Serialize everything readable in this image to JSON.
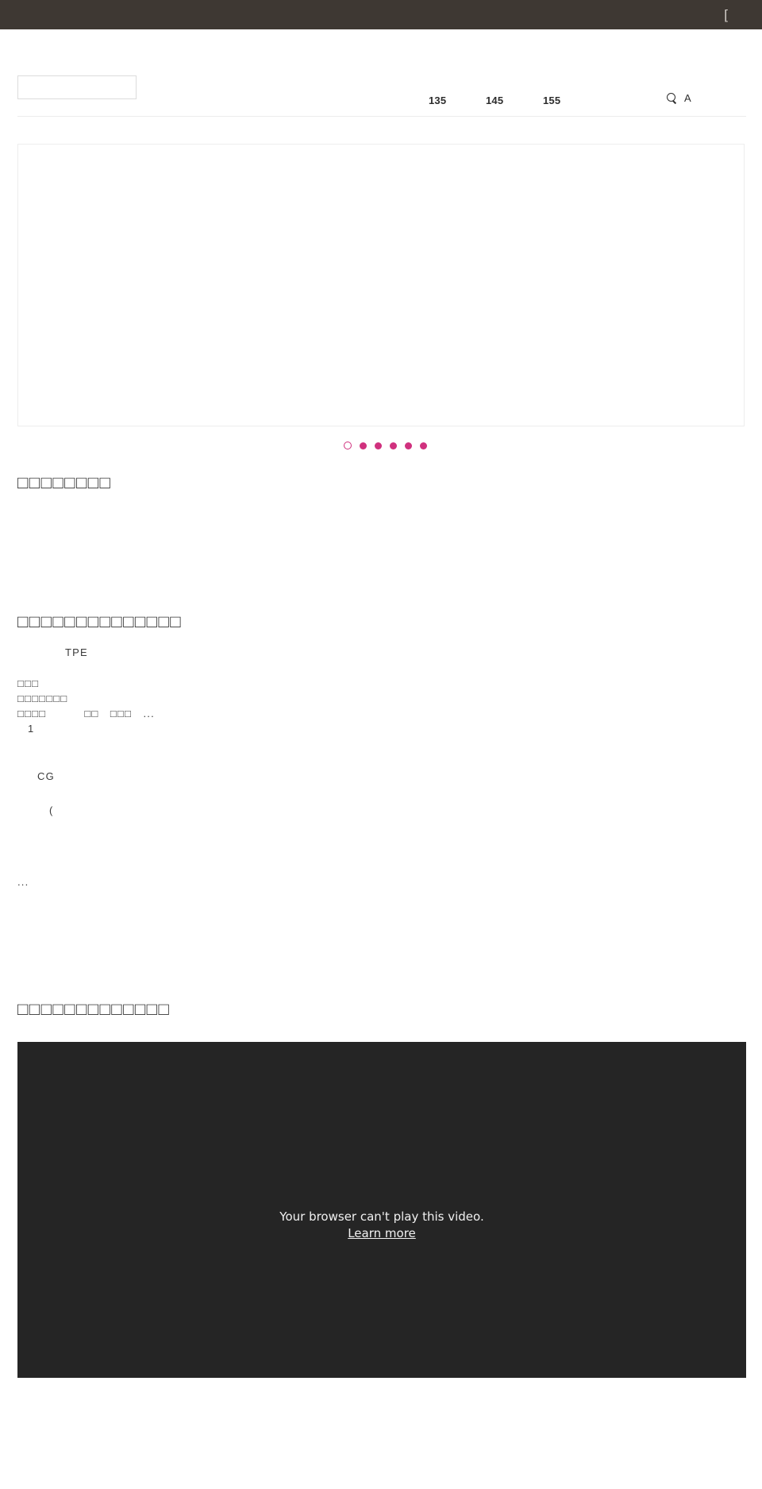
{
  "topbar": {
    "glyph_label": "[",
    "background": "#3e3833"
  },
  "header": {
    "logo_placeholder": "",
    "nav": [
      {
        "label": "135"
      },
      {
        "label": "145"
      },
      {
        "label": "155"
      }
    ],
    "tools": {
      "search_icon": "search-icon",
      "language_toggle": "A"
    }
  },
  "hero": {
    "slide_placeholder": "",
    "dots": [
      {
        "active": true
      },
      {
        "active": false
      },
      {
        "active": false
      },
      {
        "active": false
      },
      {
        "active": false
      },
      {
        "active": false
      }
    ],
    "accent_color": "#d0317e"
  },
  "sections": [
    {
      "id": "section-one",
      "title": "□□□□□□□□"
    },
    {
      "id": "section-two",
      "title": "□□□□□□□□□□□□□□",
      "paragraphs": {
        "tpe_line": "TPE",
        "line_1": "□□□",
        "line_2": "□□□□□□□",
        "line_3": "□□□□          □□   □□□   ...",
        "line_4": "1",
        "cg_line": "CG",
        "paren_line": "(",
        "ellipsis_line": "..."
      }
    },
    {
      "id": "section-three",
      "title": "□□□□□□□□□□□□□"
    }
  ],
  "video": {
    "error_message": "Your browser can't play this video.",
    "learn_more_label": "Learn more",
    "background": "#252525"
  }
}
